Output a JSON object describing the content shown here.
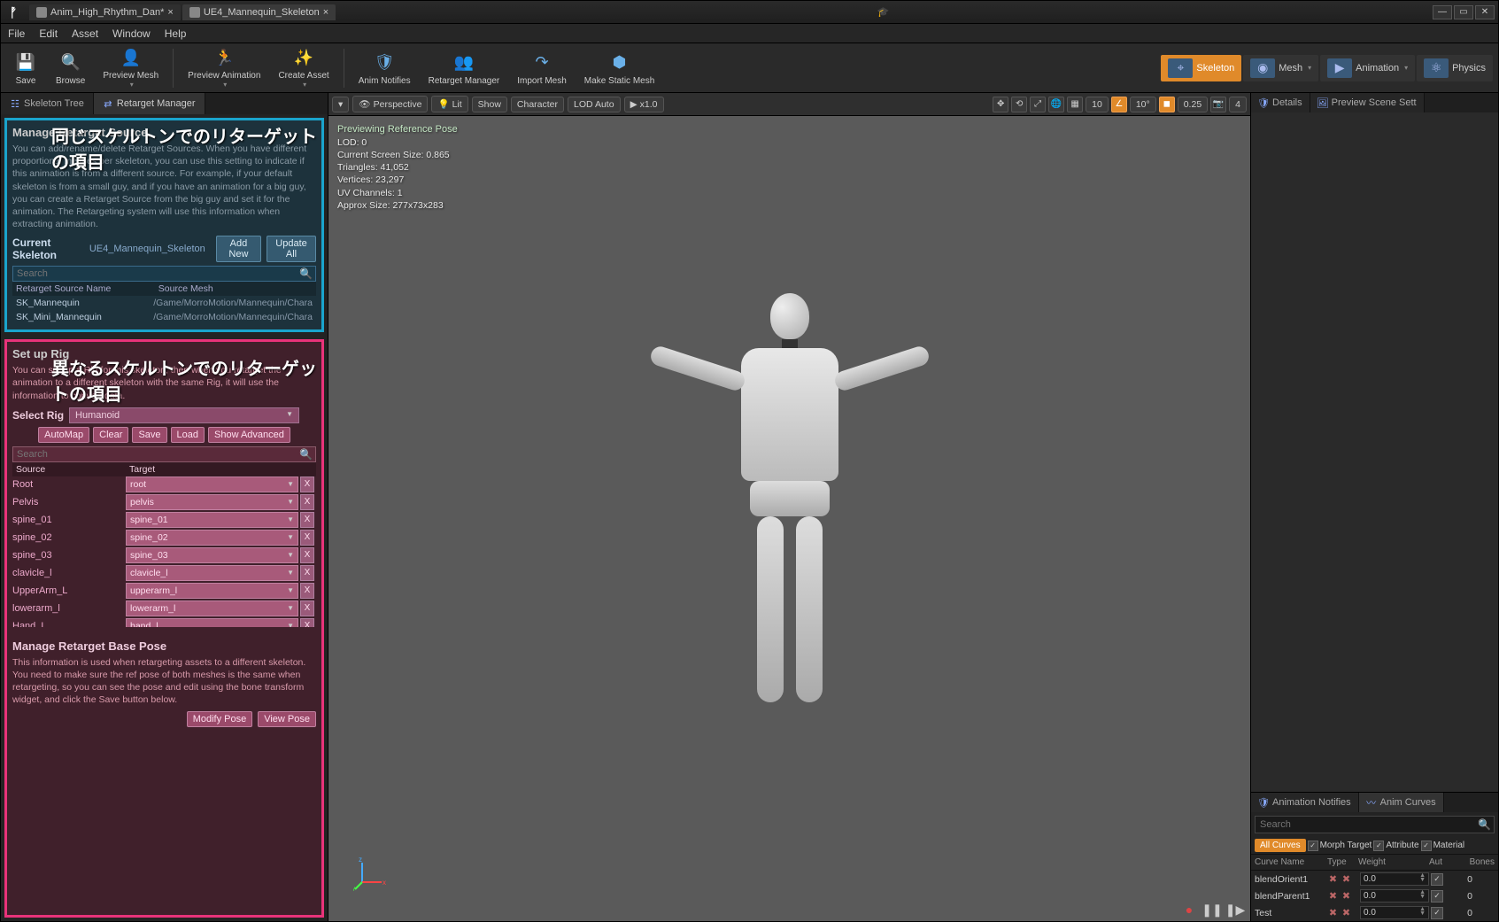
{
  "tabs": [
    "Anim_High_Rhythm_Dan*",
    "UE4_Mannequin_Skeleton"
  ],
  "menu": [
    "File",
    "Edit",
    "Asset",
    "Window",
    "Help"
  ],
  "toolbar": [
    {
      "label": "Save",
      "icon": "💾"
    },
    {
      "label": "Browse",
      "icon": "🔍"
    },
    {
      "label": "Preview Mesh",
      "icon": "👤"
    },
    {
      "label": "Preview Animation",
      "icon": "🏃"
    },
    {
      "label": "Create Asset",
      "icon": "✨"
    },
    {
      "label": "Anim Notifies",
      "icon": "🛡"
    },
    {
      "label": "Retarget Manager",
      "icon": "👥"
    },
    {
      "label": "Import Mesh",
      "icon": "↷"
    },
    {
      "label": "Make Static Mesh",
      "icon": "⬢"
    }
  ],
  "modes": [
    {
      "label": "Skeleton",
      "active": true
    },
    {
      "label": "Mesh",
      "active": false
    },
    {
      "label": "Animation",
      "active": false
    },
    {
      "label": "Physics",
      "active": false
    }
  ],
  "left_tabs": [
    "Skeleton Tree",
    "Retarget Manager"
  ],
  "active_left_tab": 1,
  "retarget_sources": {
    "title": "Manage Retarget Source",
    "overlay": "同じスケルトンでのリターゲットの項目",
    "help": "You can add/rename/delete Retarget Sources. When you have different proportional meshes per skeleton, you can use this setting to indicate if this animation is from a different source. For example, if your default skeleton is from a small guy, and if you have an animation for a big guy, you can create a Retarget Source from the big guy and set it for the animation. The Retargeting system will use this information when extracting animation.",
    "current_label": "Current Skeleton",
    "current_value": "UE4_Mannequin_Skeleton",
    "add_new": "Add New",
    "update_all": "Update All",
    "search_placeholder": "Search",
    "col_source": "Retarget Source Name",
    "col_mesh": "Source Mesh",
    "rows": [
      {
        "name": "SK_Mannequin",
        "mesh": "/Game/MorroMotion/Mannequin/Chara"
      },
      {
        "name": "SK_Mini_Mannequin",
        "mesh": "/Game/MorroMotion/Mannequin/Chara"
      }
    ]
  },
  "setup_rig": {
    "title": "Set up Rig",
    "overlay": "異なるスケルトンでのリターゲットの項目",
    "help": "You can set up a Rig for this skeleton, then when you retarget the animation to a different skeleton with the same Rig, it will use the information to convert data.",
    "select_rig_label": "Select Rig",
    "select_rig_value": "Humanoid",
    "buttons": [
      "AutoMap",
      "Clear",
      "Save",
      "Load",
      "Show Advanced"
    ],
    "search_placeholder": "Search",
    "col_source": "Source",
    "col_target": "Target",
    "rows": [
      {
        "src": "Root",
        "tgt": "root"
      },
      {
        "src": "Pelvis",
        "tgt": "pelvis"
      },
      {
        "src": "spine_01",
        "tgt": "spine_01"
      },
      {
        "src": "spine_02",
        "tgt": "spine_02"
      },
      {
        "src": "spine_03",
        "tgt": "spine_03"
      },
      {
        "src": "clavicle_l",
        "tgt": "clavicle_l"
      },
      {
        "src": "UpperArm_L",
        "tgt": "upperarm_l"
      },
      {
        "src": "lowerarm_l",
        "tgt": "lowerarm_l"
      },
      {
        "src": "Hand_L",
        "tgt": "hand_l"
      }
    ]
  },
  "base_pose": {
    "title": "Manage Retarget Base Pose",
    "help": "This information is used when retargeting assets to a different skeleton. You need to make sure the ref pose of both meshes is the same when retargeting, so you can see the pose and edit using the bone transform widget, and click the Save button below.",
    "modify": "Modify Pose",
    "view": "View Pose"
  },
  "viewport": {
    "btns": {
      "perspective": "Perspective",
      "lit": "Lit",
      "show": "Show",
      "character": "Character",
      "lod": "LOD Auto",
      "speed": "x1.0"
    },
    "snap_angle": "10°",
    "snap_dist": "0.25",
    "cam_speed": "4",
    "grid": "10",
    "info": {
      "title": "Previewing Reference Pose",
      "lod": "LOD: 0",
      "screen": "Current Screen Size: 0.865",
      "tris": "Triangles: 41,052",
      "verts": "Vertices: 23,297",
      "uv": "UV Channels: 1",
      "approx": "Approx Size: 277x73x283"
    }
  },
  "right_tabs_top": [
    "Details",
    "Preview Scene Sett"
  ],
  "right_tabs_mid": [
    "Animation Notifies",
    "Anim Curves"
  ],
  "curves": {
    "search_placeholder": "Search",
    "filters": {
      "all": "All Curves",
      "morph": "Morph Target",
      "attr": "Attribute",
      "mat": "Material"
    },
    "cols": {
      "name": "Curve Name",
      "type": "Type",
      "weight": "Weight",
      "auto": "Aut",
      "bones": "Bones"
    },
    "rows": [
      {
        "name": "blendOrient1",
        "weight": "0.0",
        "bones": "0"
      },
      {
        "name": "blendParent1",
        "weight": "0.0",
        "bones": "0"
      },
      {
        "name": "Test",
        "weight": "0.0",
        "bones": "0"
      }
    ]
  }
}
